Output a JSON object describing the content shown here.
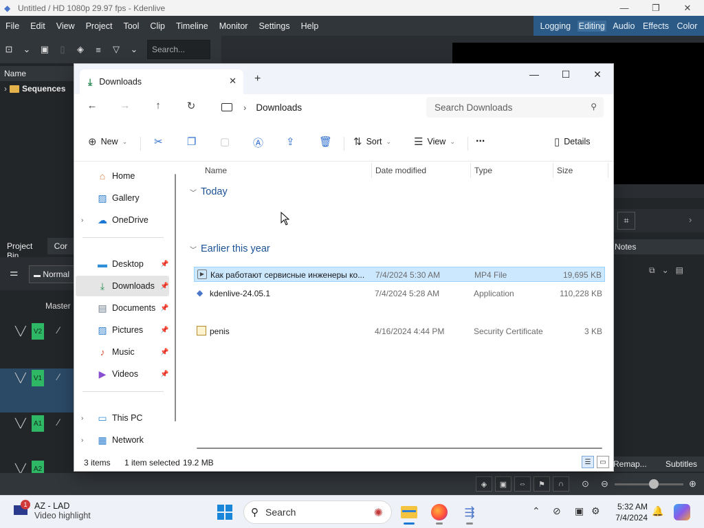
{
  "kdenlive": {
    "window_title": "Untitled / HD 1080p 29.97 fps - Kdenlive",
    "menu": [
      "File",
      "Edit",
      "View",
      "Project",
      "Tool",
      "Clip",
      "Timeline",
      "Monitor",
      "Settings",
      "Help"
    ],
    "modes": [
      "Logging",
      "Editing",
      "Audio",
      "Effects",
      "Color"
    ],
    "active_mode": "Editing",
    "search_placeholder": "Search...",
    "bin_header": "Name",
    "sequences_label": "Sequences",
    "panel_tabs": [
      "Project Bin",
      "Cor"
    ],
    "normal_label": "Normal",
    "master_label": "Master",
    "tracks": [
      "V2",
      "V1",
      "A1",
      "A2"
    ],
    "notes_label": "Notes",
    "remap_label": "Remap...",
    "subtitles_label": "Subtitles"
  },
  "explorer": {
    "tab_title": "Downloads",
    "breadcrumb": "Downloads",
    "search_placeholder": "Search Downloads",
    "commands": {
      "new": "New",
      "sort": "Sort",
      "view": "View",
      "more": "...",
      "details": "Details"
    },
    "sidebar": {
      "home": "Home",
      "gallery": "Gallery",
      "onedrive": "OneDrive",
      "desktop": "Desktop",
      "downloads": "Downloads",
      "documents": "Documents",
      "pictures": "Pictures",
      "music": "Music",
      "videos": "Videos",
      "this_pc": "This PC",
      "network": "Network"
    },
    "columns": {
      "name": "Name",
      "date": "Date modified",
      "type": "Type",
      "size": "Size"
    },
    "groups": {
      "today": "Today",
      "earlier": "Earlier this year"
    },
    "files": [
      {
        "name": "Как работают сервисные инженеры ко...",
        "date": "7/4/2024 5:30 AM",
        "type": "MP4 File",
        "size": "19,695 KB"
      },
      {
        "name": "kdenlive-24.05.1",
        "date": "7/4/2024 5:28 AM",
        "type": "Application",
        "size": "110,228 KB"
      },
      {
        "name": "penis",
        "date": "4/16/2024 4:44 PM",
        "type": "Security Certificate",
        "size": "3 KB"
      }
    ],
    "status": {
      "items": "3 items",
      "selected": "1 item selected",
      "size": "19.2 MB"
    }
  },
  "taskbar": {
    "weather_title": "AZ - LAD",
    "weather_sub": "Video highlight",
    "notification_count": "1",
    "search_placeholder": "Search",
    "time": "5:32 AM",
    "date": "7/4/2024"
  }
}
